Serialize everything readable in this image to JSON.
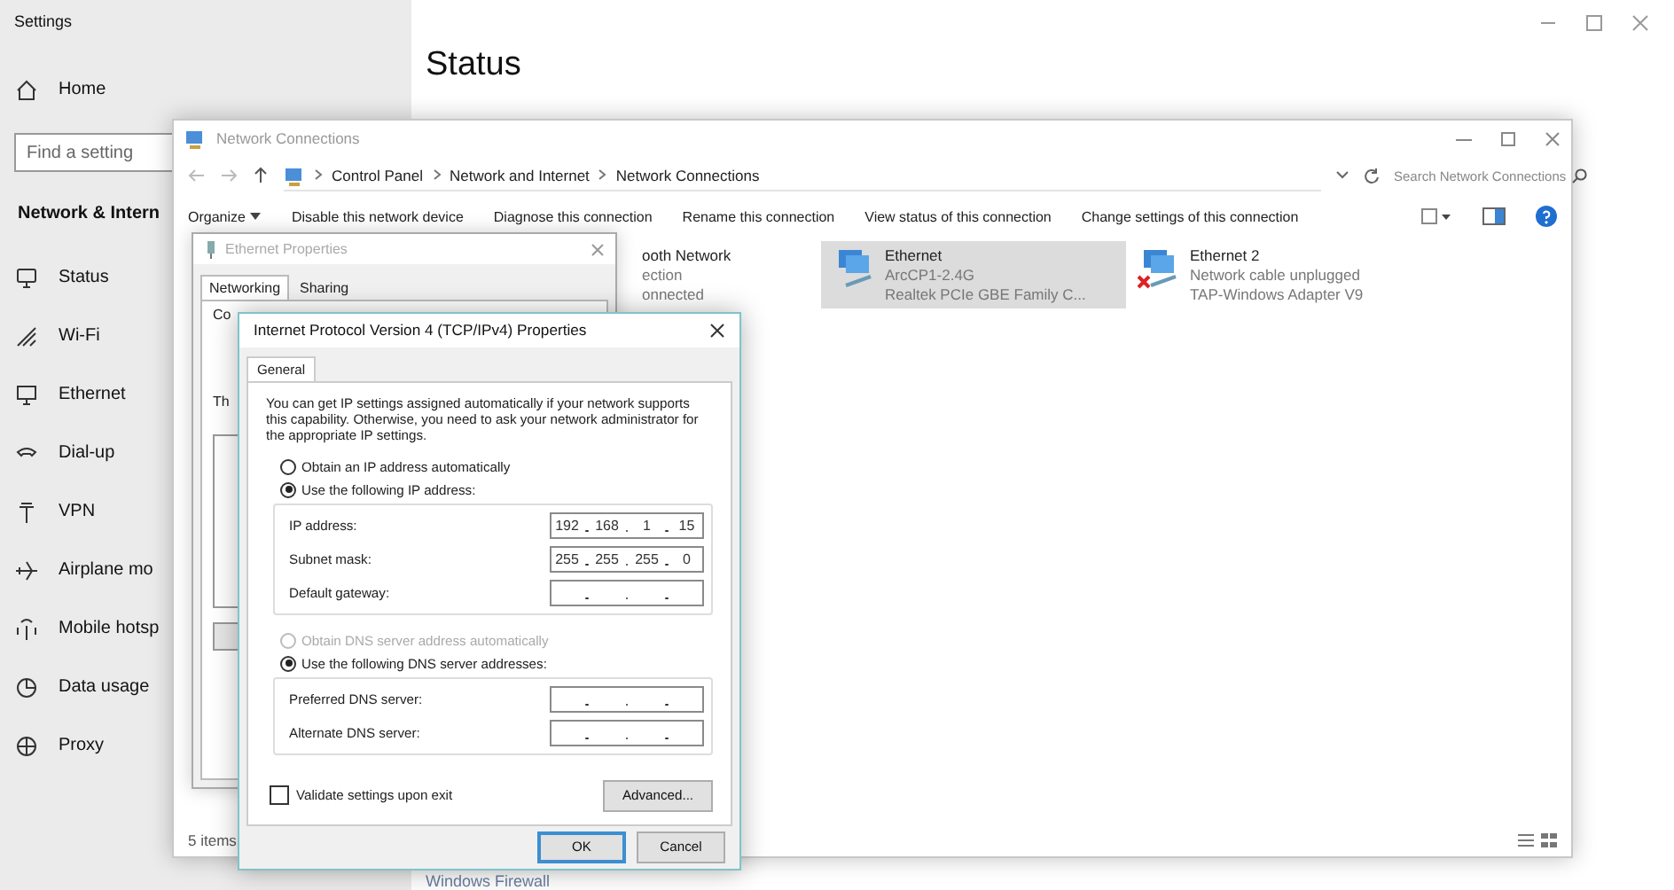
{
  "settings": {
    "title": "Settings",
    "home": "Home",
    "search": {
      "placeholder": "Find a setting"
    },
    "section": "Network & Intern",
    "heading": "Status",
    "footer_link": "Windows Firewall",
    "nav": [
      {
        "label": "Status"
      },
      {
        "label": "Wi-Fi"
      },
      {
        "label": "Ethernet"
      },
      {
        "label": "Dial-up"
      },
      {
        "label": "VPN"
      },
      {
        "label": "Airplane mo"
      },
      {
        "label": "Mobile hotsp"
      },
      {
        "label": "Data usage"
      },
      {
        "label": "Proxy"
      }
    ]
  },
  "network_connections": {
    "title": "Network Connections",
    "breadcrumb": [
      "Control Panel",
      "Network and Internet",
      "Network Connections"
    ],
    "search": {
      "placeholder": "Search Network Connections"
    },
    "toolbar": [
      "Organize",
      "Disable this network device",
      "Diagnose this connection",
      "Rename this connection",
      "View status of this connection",
      "Change settings of this connection"
    ],
    "items": [
      {
        "kind": "fragment",
        "name": "ooth Network",
        "details": [
          "ection",
          "onnected"
        ],
        "selected": false,
        "disconnected": false
      },
      {
        "kind": "adapter",
        "name": "Ethernet",
        "details": [
          "ArcCP1-2.4G",
          "Realtek PCIe GBE Family C..."
        ],
        "selected": true,
        "disconnected": false
      },
      {
        "kind": "adapter",
        "name": "Ethernet 2",
        "details": [
          "Network cable unplugged",
          "TAP-Windows Adapter V9"
        ],
        "selected": false,
        "disconnected": true
      }
    ],
    "status": "5 items"
  },
  "ethernet_properties": {
    "title": "Ethernet Properties",
    "tabs": [
      {
        "label": "Networking",
        "selected": true
      },
      {
        "label": "Sharing",
        "selected": false
      }
    ],
    "fragments": [
      "Co",
      "Th"
    ]
  },
  "ipv4_dialog": {
    "title": "Internet Protocol Version 4 (TCP/IPv4) Properties",
    "tabs": [
      {
        "label": "General",
        "selected": true
      }
    ],
    "description": "You can get IP settings assigned automatically if your network supports this capability. Otherwise, you need to ask your network administrator for the appropriate IP settings.",
    "ip_options": [
      {
        "label": "Obtain an IP address automatically",
        "selected": false,
        "disabled": false
      },
      {
        "label": "Use the following IP address:",
        "selected": true,
        "disabled": false
      }
    ],
    "ip_fields": [
      {
        "label": "IP address:",
        "octets": [
          "192",
          "168",
          "1",
          "15"
        ]
      },
      {
        "label": "Subnet mask:",
        "octets": [
          "255",
          "255",
          "255",
          "0"
        ]
      },
      {
        "label": "Default gateway:"
      }
    ],
    "dns_options": [
      {
        "label": "Obtain DNS server address automatically",
        "selected": false,
        "disabled": true
      },
      {
        "label": "Use the following DNS server addresses:",
        "selected": true,
        "disabled": false
      }
    ],
    "dns_fields": [
      {
        "label": "Preferred DNS server:"
      },
      {
        "label": "Alternate DNS server:"
      }
    ],
    "validate": {
      "label": "Validate settings upon exit",
      "checked": false
    },
    "advanced_button": "Advanced...",
    "footer_buttons": [
      {
        "label": "OK",
        "default": true
      },
      {
        "label": "Cancel",
        "default": false
      }
    ]
  }
}
